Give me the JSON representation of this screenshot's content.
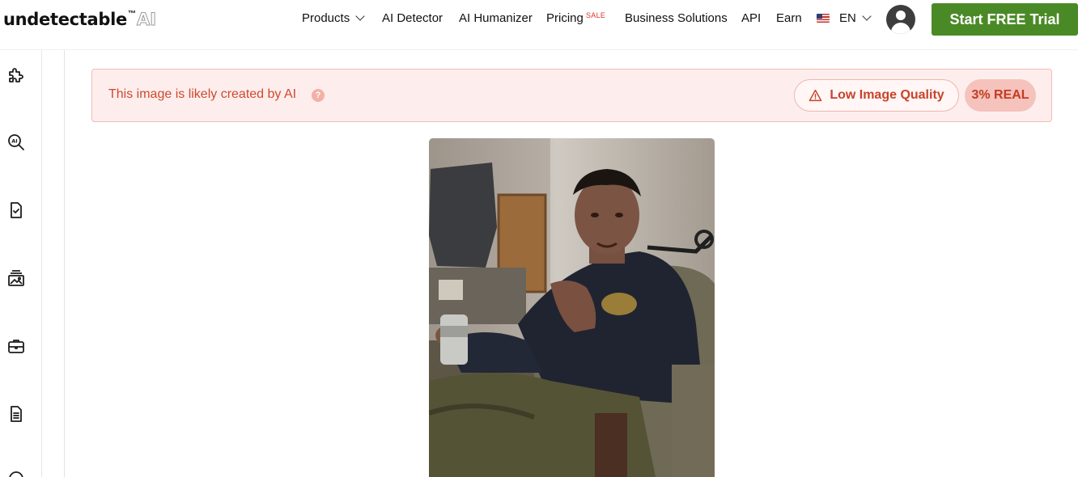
{
  "brand": {
    "name": "undetectable",
    "tm": "™",
    "suffix": "AI"
  },
  "nav": {
    "products": "Products",
    "ai_detector": "AI Detector",
    "ai_humanizer": "AI Humanizer",
    "pricing": "Pricing",
    "pricing_badge": "SALE",
    "business": "Business Solutions",
    "api": "API",
    "earn": "Earn",
    "language": "EN",
    "cta": "Start FREE Trial"
  },
  "sidebar": {
    "items": [
      {
        "icon": "puzzle-icon"
      },
      {
        "icon": "ai-search-icon"
      },
      {
        "icon": "document-check-icon"
      },
      {
        "icon": "image-stack-icon"
      },
      {
        "icon": "briefcase-icon"
      },
      {
        "icon": "document-lines-icon"
      }
    ]
  },
  "result": {
    "message": "This image is likely created by AI",
    "help": "?",
    "quality_label": "Low Image Quality",
    "score": "3% REAL"
  },
  "colors": {
    "cta": "#4a8a26",
    "alert_bg": "#fdeeed",
    "alert_text": "#d0482e",
    "score_bg": "#f6c2bc"
  }
}
